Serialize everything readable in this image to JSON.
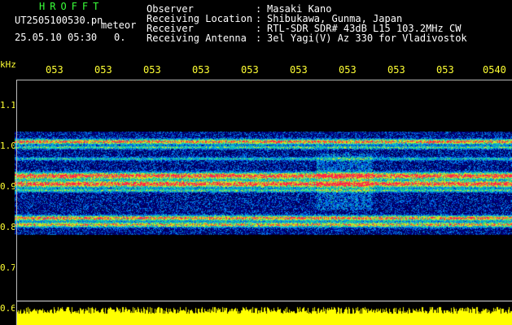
{
  "header": {
    "brand": "HROFFT",
    "filename": "UT2505100530.pn",
    "meteor_label": "meteor",
    "datetime": "25.05.10 05:30",
    "count": "0."
  },
  "meta": [
    {
      "label": "Observer",
      "value": "Masaki Kano"
    },
    {
      "label": "Receiving Location",
      "value": "Shibukawa, Gunma, Japan"
    },
    {
      "label": "Receiver",
      "value": "RTL-SDR SDR# 43dB L15 103.2MHz CW"
    },
    {
      "label": "Receiving Antenna",
      "value": "3el Yagi(V) Az 330 for Vladivostok"
    }
  ],
  "meta_colon": ":",
  "y_axis": {
    "unit": "kHz",
    "ticks": [
      "1.1",
      "1.0",
      "0.9",
      "0.8",
      "0.7",
      "0.6"
    ]
  },
  "x_axis": {
    "ticks": [
      "053",
      "053",
      "053",
      "053",
      "053",
      "053",
      "053",
      "053",
      "053",
      "0540"
    ]
  },
  "colors": {
    "background": "#000000",
    "noise_field": "#000080",
    "echo_band": "#ff2040",
    "signal_bar": "#ffff00",
    "label_green": "#39ff39",
    "label_yellow": "#ffff33"
  }
}
